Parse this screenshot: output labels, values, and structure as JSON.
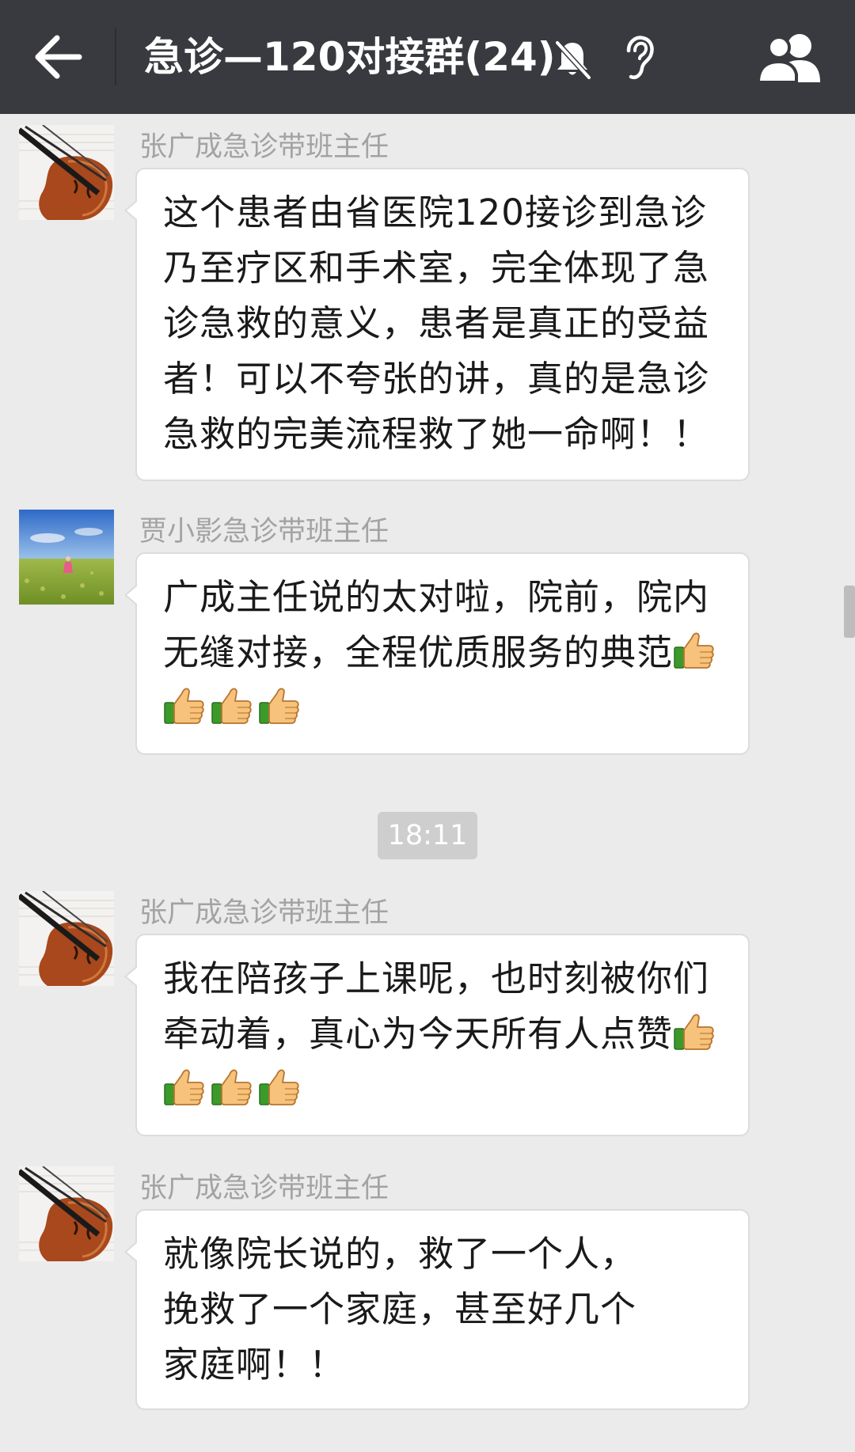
{
  "header": {
    "title": "急诊—120对接群(24)",
    "back_icon": "arrow-left-icon",
    "mute_icon": "bell-muted-icon",
    "ear_icon": "earpiece-mode-icon",
    "members_icon": "group-members-icon",
    "background": "#393a3f"
  },
  "messages": [
    {
      "sender": "张广成急诊带班主任",
      "avatar": "violin-avatar",
      "text": "这个患者由省医院120接诊到急诊乃至疗区和手术室，完全体现了急诊急救的意义，患者是真正的受益者！可以不夸张的讲，真的是急诊急救的完美流程救了她一命啊！！",
      "thumbs": 0
    },
    {
      "sender": "贾小影急诊带班主任",
      "avatar": "field-landscape-avatar",
      "text": "广成主任说的太对啦，院前，院内无缝对接，全程优质服务的典范",
      "thumbs": 4
    },
    {
      "sender": "张广成急诊带班主任",
      "avatar": "violin-avatar",
      "text": "我在陪孩子上课呢，也时刻被你们牵动着，真心为今天所有人点赞",
      "thumbs": 4
    },
    {
      "sender": "张广成急诊带班主任",
      "avatar": "violin-avatar",
      "text": "就像院长说的，救了一个人，挽救了一个家庭，甚至好几个家庭啊！！",
      "thumbs": 0
    }
  ],
  "timestamp": "18:11",
  "colors": {
    "chat_background": "#ebebeb",
    "bubble": "#ffffff",
    "sender_name": "#a3a3a3",
    "timestamp_bg": "#cecece"
  }
}
